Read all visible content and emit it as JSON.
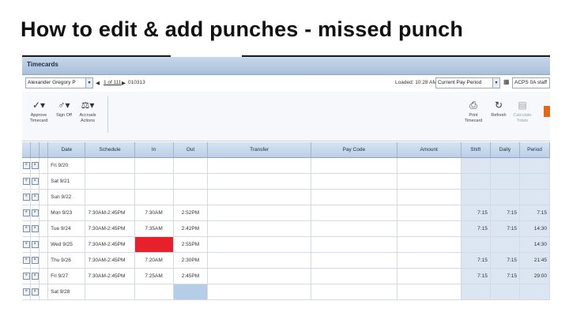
{
  "slide": {
    "title": "How to edit & add punches - missed punch"
  },
  "window": {
    "title": "Timecards"
  },
  "employee": {
    "name": "Alexander Gregory P",
    "pager": "1 of 111",
    "id": "010313"
  },
  "header_right": {
    "loaded": "Loaded: 10:28 AM",
    "period": "Current Pay Period",
    "staff_group": "ACPS 0A staff"
  },
  "toolbar": {
    "approve": "Approve Timecard",
    "signoff": "Sign Off",
    "accruals": "Accruals Actions",
    "print": "Print Timecard",
    "refresh": "Refresh",
    "calculate": "Calculate Totals"
  },
  "icons": {
    "approve": "checkmark-icon",
    "signoff": "signoff-icon",
    "accruals": "accruals-icon",
    "print": "printer-icon",
    "refresh": "refresh-icon",
    "calculate": "calculator-icon",
    "add": "plus-icon",
    "delete": "x-icon"
  },
  "grid": {
    "columns": [
      "Date",
      "Schedule",
      "In",
      "Out",
      "Transfer",
      "Pay Code",
      "Amount",
      "Shift",
      "Daily",
      "Period"
    ],
    "rows": [
      {
        "date": "Fri 9/20",
        "schedule": "",
        "in": "",
        "out": "",
        "transfer": "",
        "paycode": "",
        "amount": "",
        "shift": "",
        "daily": "",
        "period": ""
      },
      {
        "date": "Sat 9/21",
        "schedule": "",
        "in": "",
        "out": "",
        "transfer": "",
        "paycode": "",
        "amount": "",
        "shift": "",
        "daily": "",
        "period": ""
      },
      {
        "date": "Sun 9/22",
        "schedule": "",
        "in": "",
        "out": "",
        "transfer": "",
        "paycode": "",
        "amount": "",
        "shift": "",
        "daily": "",
        "period": ""
      },
      {
        "date": "Mon 9/23",
        "schedule": "7:30AM-2:45PM",
        "in": "7:30AM",
        "out": "2:52PM",
        "transfer": "",
        "paycode": "",
        "amount": "",
        "shift": "7:15",
        "daily": "7:15",
        "period": "7:15"
      },
      {
        "date": "Tue 9/24",
        "schedule": "7:30AM-2:45PM",
        "in": "7:35AM",
        "out": "2:42PM",
        "transfer": "",
        "paycode": "",
        "amount": "",
        "shift": "7:15",
        "daily": "7:15",
        "period": "14:30"
      },
      {
        "date": "Wed 9/25",
        "schedule": "7:30AM-2:45PM",
        "in": "",
        "out": "2:55PM",
        "transfer": "",
        "paycode": "",
        "amount": "",
        "shift": "",
        "daily": "",
        "period": "14:30"
      },
      {
        "date": "Thu 9/26",
        "schedule": "7:30AM-2:45PM",
        "in": "7:20AM",
        "out": "2:30PM",
        "transfer": "",
        "paycode": "",
        "amount": "",
        "shift": "7:15",
        "daily": "7:15",
        "period": "21:45"
      },
      {
        "date": "Fri 9/27",
        "schedule": "7:30AM-2:45PM",
        "in": "7:25AM",
        "out": "2:45PM",
        "transfer": "",
        "paycode": "",
        "amount": "",
        "shift": "7:15",
        "daily": "7:15",
        "period": "29:00"
      },
      {
        "date": "Sat 9/28",
        "schedule": "",
        "in": "",
        "out": "",
        "transfer": "",
        "paycode": "",
        "amount": "",
        "shift": "",
        "daily": "",
        "period": ""
      }
    ]
  },
  "colors": {
    "missed_punch": "#e8202a",
    "total_column": "#dce6f2",
    "selected_cell": "#b5cde6"
  }
}
